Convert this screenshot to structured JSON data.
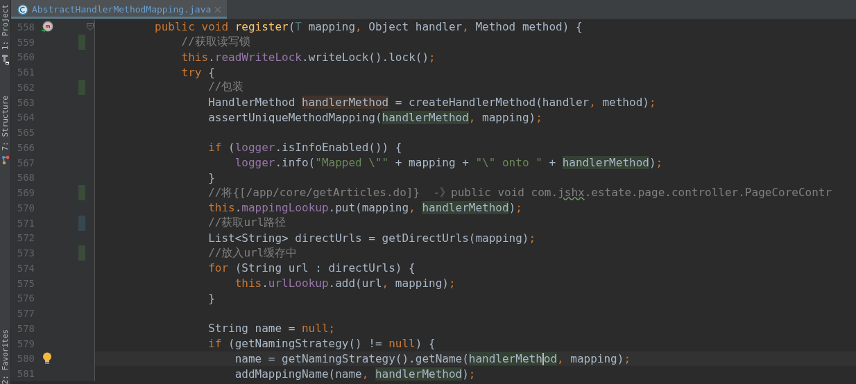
{
  "tool_windows": [
    {
      "label": "1: Project"
    },
    {
      "label": "7: Structure"
    },
    {
      "label": "2: Favorites"
    }
  ],
  "tabs": [
    {
      "label": "AbstractHandlerMethodMapping.java",
      "selected": true
    }
  ],
  "lines": [
    {
      "number": "558",
      "fold": true,
      "gutter": {
        "kind": "method"
      },
      "tokens": [
        {
          "t": "        public void ",
          "kind": "kw"
        },
        {
          "t": "register",
          "kind": "fn"
        },
        {
          "t": "(",
          "kind": "plain"
        },
        {
          "t": "T",
          "kind": "tparam"
        },
        {
          "t": " mapping",
          "kind": "plain"
        },
        {
          "t": ", ",
          "kind": "kw"
        },
        {
          "t": "Object handler",
          "kind": "plain"
        },
        {
          "t": ", ",
          "kind": "kw"
        },
        {
          "t": "Method method) {",
          "kind": "plain"
        }
      ]
    },
    {
      "number": "559",
      "change": {
        "kind": "added"
      },
      "tokens": [
        {
          "t": "            //获取读写锁",
          "kind": "cmt"
        }
      ]
    },
    {
      "number": "560",
      "tokens": [
        {
          "t": "            this",
          "kind": "kw"
        },
        {
          "t": ".",
          "kind": "plain"
        },
        {
          "t": "readWriteLock",
          "kind": "field"
        },
        {
          "t": ".writeLock().lock()",
          "kind": "plain"
        },
        {
          "t": ";",
          "kind": "kw"
        }
      ]
    },
    {
      "number": "561",
      "tokens": [
        {
          "t": "            try",
          "kind": "kw"
        },
        {
          "t": " {",
          "kind": "plain"
        }
      ]
    },
    {
      "number": "562",
      "change": {
        "kind": "added"
      },
      "tokens": [
        {
          "t": "                //包装",
          "kind": "cmt"
        }
      ]
    },
    {
      "number": "563",
      "tokens": [
        {
          "t": "                HandlerMethod ",
          "kind": "plain"
        },
        {
          "t": "handlerMethod",
          "kind": "var_write"
        },
        {
          "t": " = createHandlerMethod(handler",
          "kind": "plain"
        },
        {
          "t": ", ",
          "kind": "kw"
        },
        {
          "t": "method)",
          "kind": "plain"
        },
        {
          "t": ";",
          "kind": "kw"
        }
      ]
    },
    {
      "number": "564",
      "tokens": [
        {
          "t": "                assertUniqueMethodMapping(",
          "kind": "plain"
        },
        {
          "t": "handlerMethod",
          "kind": "var_read"
        },
        {
          "t": ", ",
          "kind": "kw"
        },
        {
          "t": "mapping)",
          "kind": "plain"
        },
        {
          "t": ";",
          "kind": "kw"
        }
      ]
    },
    {
      "number": "565"
    },
    {
      "number": "566",
      "tokens": [
        {
          "t": "                if",
          "kind": "kw"
        },
        {
          "t": " (",
          "kind": "plain"
        },
        {
          "t": "logger",
          "kind": "field"
        },
        {
          "t": ".isInfoEnabled()) {",
          "kind": "plain"
        }
      ]
    },
    {
      "number": "567",
      "tokens": [
        {
          "t": "                    logger",
          "kind": "field"
        },
        {
          "t": ".info(",
          "kind": "plain"
        },
        {
          "t": "\"Mapped \\\"\"",
          "kind": "str"
        },
        {
          "t": " + mapping + ",
          "kind": "plain"
        },
        {
          "t": "\"\\\" onto \"",
          "kind": "str"
        },
        {
          "t": " + ",
          "kind": "plain"
        },
        {
          "t": "handlerMethod",
          "kind": "var_read"
        },
        {
          "t": ")",
          "kind": "plain"
        },
        {
          "t": ";",
          "kind": "kw"
        }
      ]
    },
    {
      "number": "568",
      "tokens": [
        {
          "t": "                }",
          "kind": "plain"
        }
      ]
    },
    {
      "number": "569",
      "change": {
        "kind": "added"
      },
      "tokens": [
        {
          "t": "                //将{[/app/core/getArticles.do]}  -》public void com.",
          "kind": "cmt"
        },
        {
          "t": "jshx",
          "kind": "cmt_typo"
        },
        {
          "t": ".estate.page.controller.PageCoreContr",
          "kind": "cmt"
        }
      ]
    },
    {
      "number": "570",
      "tokens": [
        {
          "t": "                this",
          "kind": "kw"
        },
        {
          "t": ".",
          "kind": "plain"
        },
        {
          "t": "mappingLookup",
          "kind": "field"
        },
        {
          "t": ".put(mapping",
          "kind": "plain"
        },
        {
          "t": ", ",
          "kind": "kw"
        },
        {
          "t": "handlerMethod",
          "kind": "var_read"
        },
        {
          "t": ")",
          "kind": "plain"
        },
        {
          "t": ";",
          "kind": "kw"
        }
      ]
    },
    {
      "number": "571",
      "change": {
        "kind": "modified"
      },
      "tokens": [
        {
          "t": "                //获取url路径",
          "kind": "cmt"
        }
      ]
    },
    {
      "number": "572",
      "tokens": [
        {
          "t": "                List<String> directUrls = getDirectUrls(mapping)",
          "kind": "plain"
        },
        {
          "t": ";",
          "kind": "kw"
        }
      ]
    },
    {
      "number": "573",
      "change": {
        "kind": "added"
      },
      "tokens": [
        {
          "t": "                //放入url缓存中",
          "kind": "cmt"
        }
      ]
    },
    {
      "number": "574",
      "tokens": [
        {
          "t": "                for",
          "kind": "kw"
        },
        {
          "t": " (String url : directUrls) {",
          "kind": "plain"
        }
      ]
    },
    {
      "number": "575",
      "tokens": [
        {
          "t": "                    this",
          "kind": "kw"
        },
        {
          "t": ".",
          "kind": "plain"
        },
        {
          "t": "urlLookup",
          "kind": "field"
        },
        {
          "t": ".add(url",
          "kind": "plain"
        },
        {
          "t": ", ",
          "kind": "kw"
        },
        {
          "t": "mapping)",
          "kind": "plain"
        },
        {
          "t": ";",
          "kind": "kw"
        }
      ]
    },
    {
      "number": "576",
      "tokens": [
        {
          "t": "                }",
          "kind": "plain"
        }
      ]
    },
    {
      "number": "577"
    },
    {
      "number": "578",
      "tokens": [
        {
          "t": "                String name = ",
          "kind": "plain"
        },
        {
          "t": "null;",
          "kind": "kw"
        }
      ]
    },
    {
      "number": "579",
      "tokens": [
        {
          "t": "                if",
          "kind": "kw"
        },
        {
          "t": " (getNamingStrategy() != ",
          "kind": "plain"
        },
        {
          "t": "null",
          "kind": "kw"
        },
        {
          "t": ") {",
          "kind": "plain"
        }
      ]
    },
    {
      "number": "580",
      "current": true,
      "gutter": {
        "kind": "bulb"
      },
      "tokens": [
        {
          "t": "                    name = getNamingStrategy().getName(",
          "kind": "plain"
        },
        {
          "t": "handlerMeth",
          "kind": "var_read",
          "caret": true
        },
        {
          "t": "od",
          "kind": "var_read"
        },
        {
          "t": ", ",
          "kind": "kw"
        },
        {
          "t": "mapping)",
          "kind": "plain"
        },
        {
          "t": ";",
          "kind": "kw"
        }
      ]
    },
    {
      "number": "581",
      "tokens": [
        {
          "t": "                    addMappingName(name",
          "kind": "plain"
        },
        {
          "t": ", ",
          "kind": "kw"
        },
        {
          "t": "handlerMethod",
          "kind": "var_read"
        },
        {
          "t": ")",
          "kind": "plain"
        },
        {
          "t": ";",
          "kind": "kw"
        }
      ]
    }
  ]
}
